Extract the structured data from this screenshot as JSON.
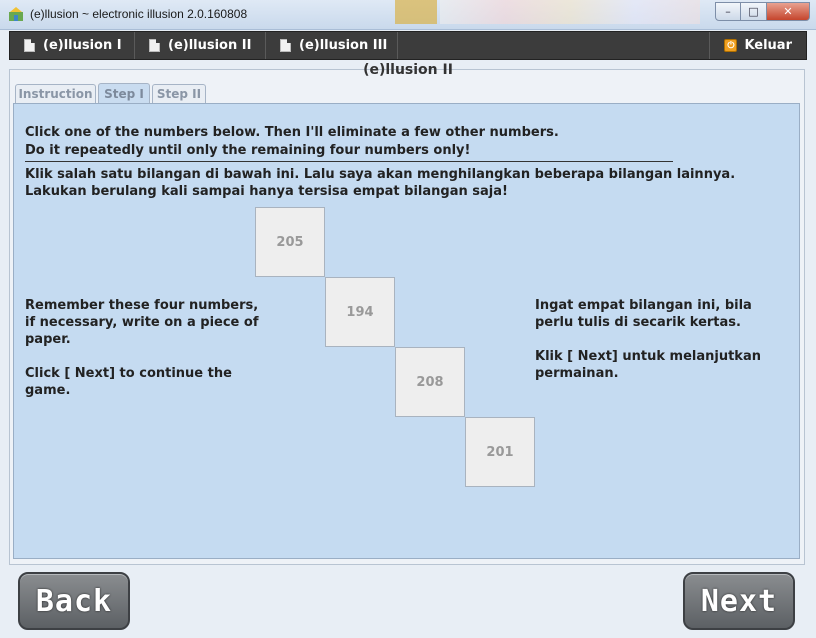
{
  "window": {
    "title": "(e)llusion ~ electronic illusion 2.0.160808",
    "minimize": "–",
    "maximize": "□",
    "close": "✕"
  },
  "menu": {
    "items": [
      {
        "label": "(e)llusion I"
      },
      {
        "label": "(e)llusion II"
      },
      {
        "label": "(e)llusion III"
      }
    ],
    "exit_label": "Keluar"
  },
  "panel_title": "(e)llusion II",
  "tabs": [
    {
      "label": "Instruction",
      "active": false
    },
    {
      "label": "Step I",
      "active": true
    },
    {
      "label": "Step II",
      "active": false
    }
  ],
  "instructions": {
    "en_line1": "Click one of the numbers below. Then I'll eliminate a few other numbers.",
    "en_line2": "Do it repeatedly until only the remaining four numbers only!",
    "id_line1": "Klik salah satu bilangan di bawah ini. Lalu saya akan menghilangkan beberapa bilangan lainnya.",
    "id_line2": "Lakukan berulang kali sampai hanya tersisa empat bilangan saja!"
  },
  "left_text": {
    "p1_l1": "Remember these four numbers,",
    "p1_l2": "if necessary, write on a piece of",
    "p1_l3": "paper.",
    "p2_l1": "Click [ Next] to continue the",
    "p2_l2": "game."
  },
  "right_text": {
    "p1_l1": "Ingat empat bilangan ini, bila",
    "p1_l2": "perlu tulis di secarik kertas.",
    "p2_l1": "Klik [ Next] untuk melanjutkan",
    "p2_l2": "permainan."
  },
  "numbers": [
    "205",
    "194",
    "208",
    "201"
  ],
  "buttons": {
    "back": "Back",
    "next": "Next"
  }
}
